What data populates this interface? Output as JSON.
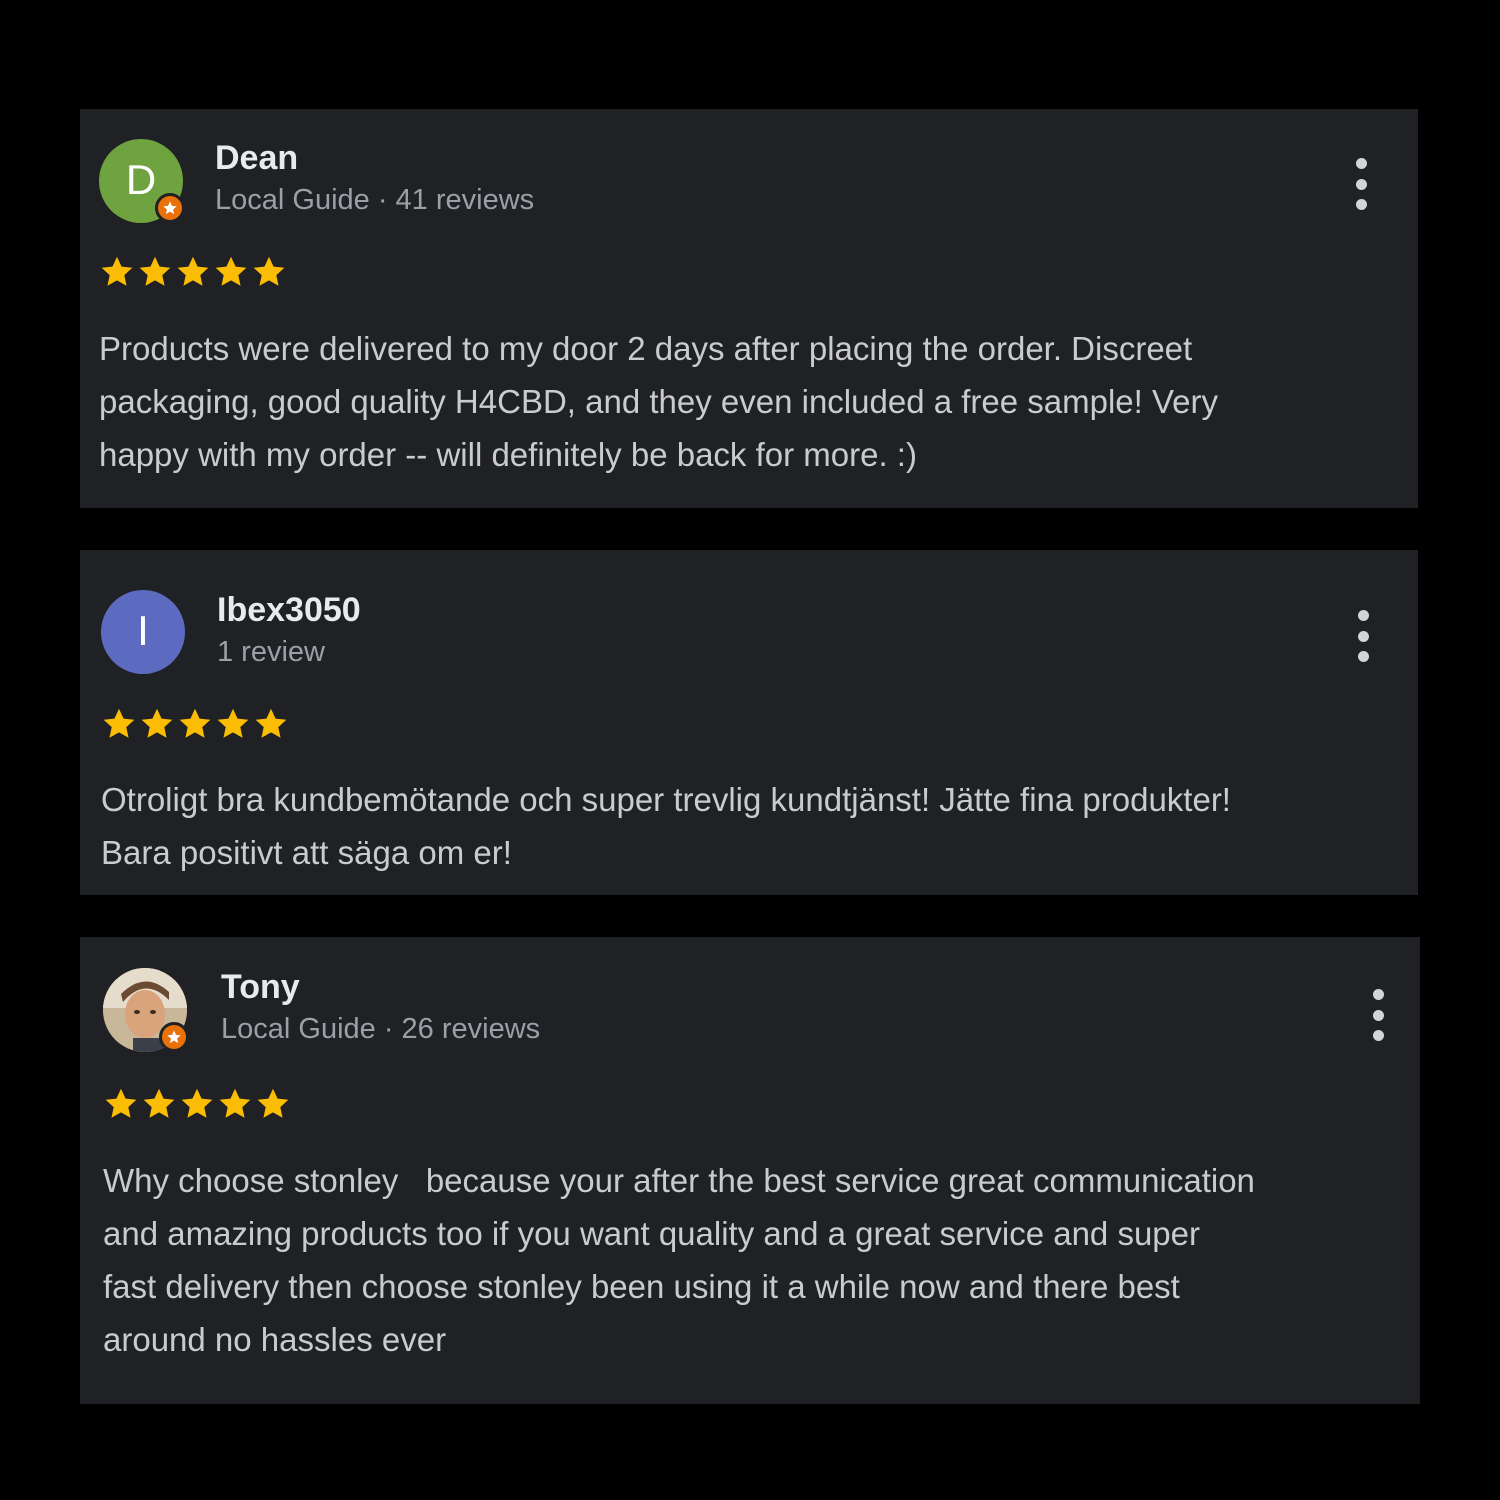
{
  "reviews": [
    {
      "name": "Dean",
      "meta": "Local Guide · 41 reviews",
      "avatar_letter": "D",
      "avatar_color": "#6fa33f",
      "local_guide": true,
      "rating": 5,
      "text": "Products were delivered to my door 2 days after placing the order. Discreet\npackaging, good quality H4CBD, and they even included a free sample! Very\nhappy with my order -- will definitely be back for more. :)"
    },
    {
      "name": "Ibex3050",
      "meta": "1 review",
      "avatar_letter": "I",
      "avatar_color": "#5c6bc0",
      "local_guide": false,
      "rating": 5,
      "text": "Otroligt bra kundbemötande och super trevlig kundtjänst! Jätte fina produkter!\nBara positivt att säga om er!"
    },
    {
      "name": "Tony",
      "meta": "Local Guide · 26 reviews",
      "avatar_letter": "",
      "avatar_color": "#b08a63",
      "local_guide": true,
      "rating": 5,
      "text": "Why choose stonley   because your after the best service great communication\nand amazing products too if you want quality and a great service and super\nfast delivery then choose stonley been using it a while now and there best\naround no hassles ever"
    }
  ],
  "colors": {
    "background": "#000000",
    "card": "#202124",
    "star": "#fbbc04",
    "badge": "#e8710a"
  },
  "icons": {
    "more": "more-vert-icon",
    "star": "star-icon",
    "badge": "local-guide-badge-icon"
  }
}
